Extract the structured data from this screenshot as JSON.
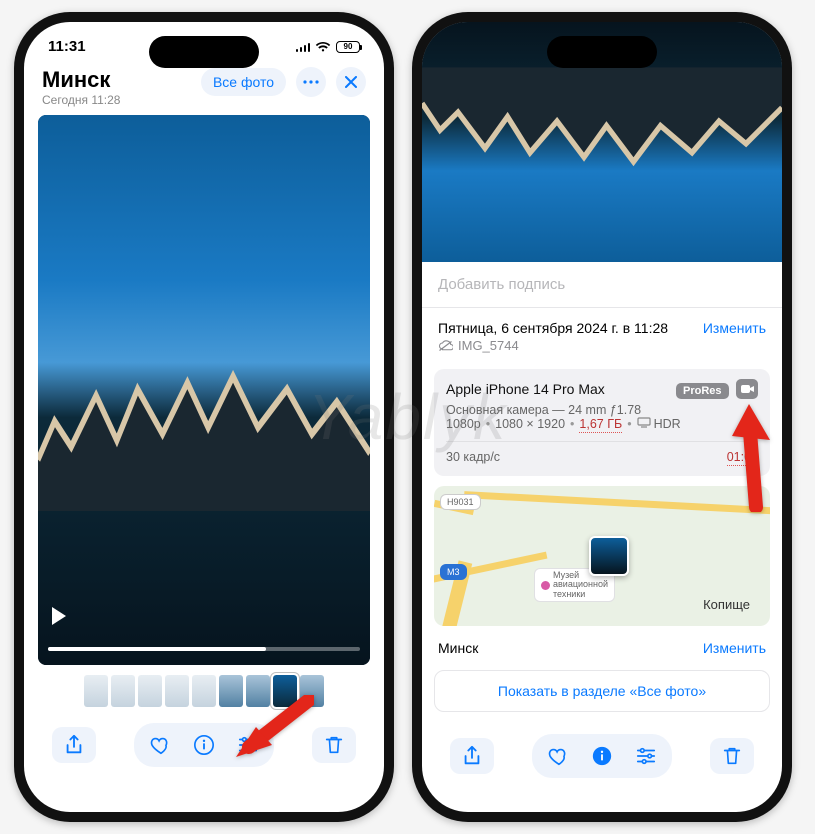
{
  "statusbar": {
    "time": "11:31",
    "battery": "90"
  },
  "phone1": {
    "title": "Минск",
    "subtitle": "Сегодня 11:28",
    "all_photos": "Все фото"
  },
  "phone2": {
    "caption_placeholder": "Добавить подпись",
    "date": "Пятница, 6 сентября 2024 г. в 11:28",
    "edit": "Изменить",
    "filename": "IMG_5744",
    "device": "Apple iPhone 14 Pro Max",
    "badge_prores": "ProRes",
    "lens": "Основная камера — 24 mm ƒ1.78",
    "spec_res": "1080p",
    "spec_dims": "1080 × 1920",
    "spec_size": "1,67 ГБ",
    "spec_hdr": "HDR",
    "fps": "30 кадр/с",
    "duration": "01:00",
    "map_city": "Минск",
    "map_place": "Копище",
    "map_road_1": "H9031",
    "map_road_2": "М3",
    "map_poi": "Музей\nавиационной\nтехники",
    "show_all": "Показать в разделе «Все фото»"
  },
  "watermark": "Yablyk"
}
